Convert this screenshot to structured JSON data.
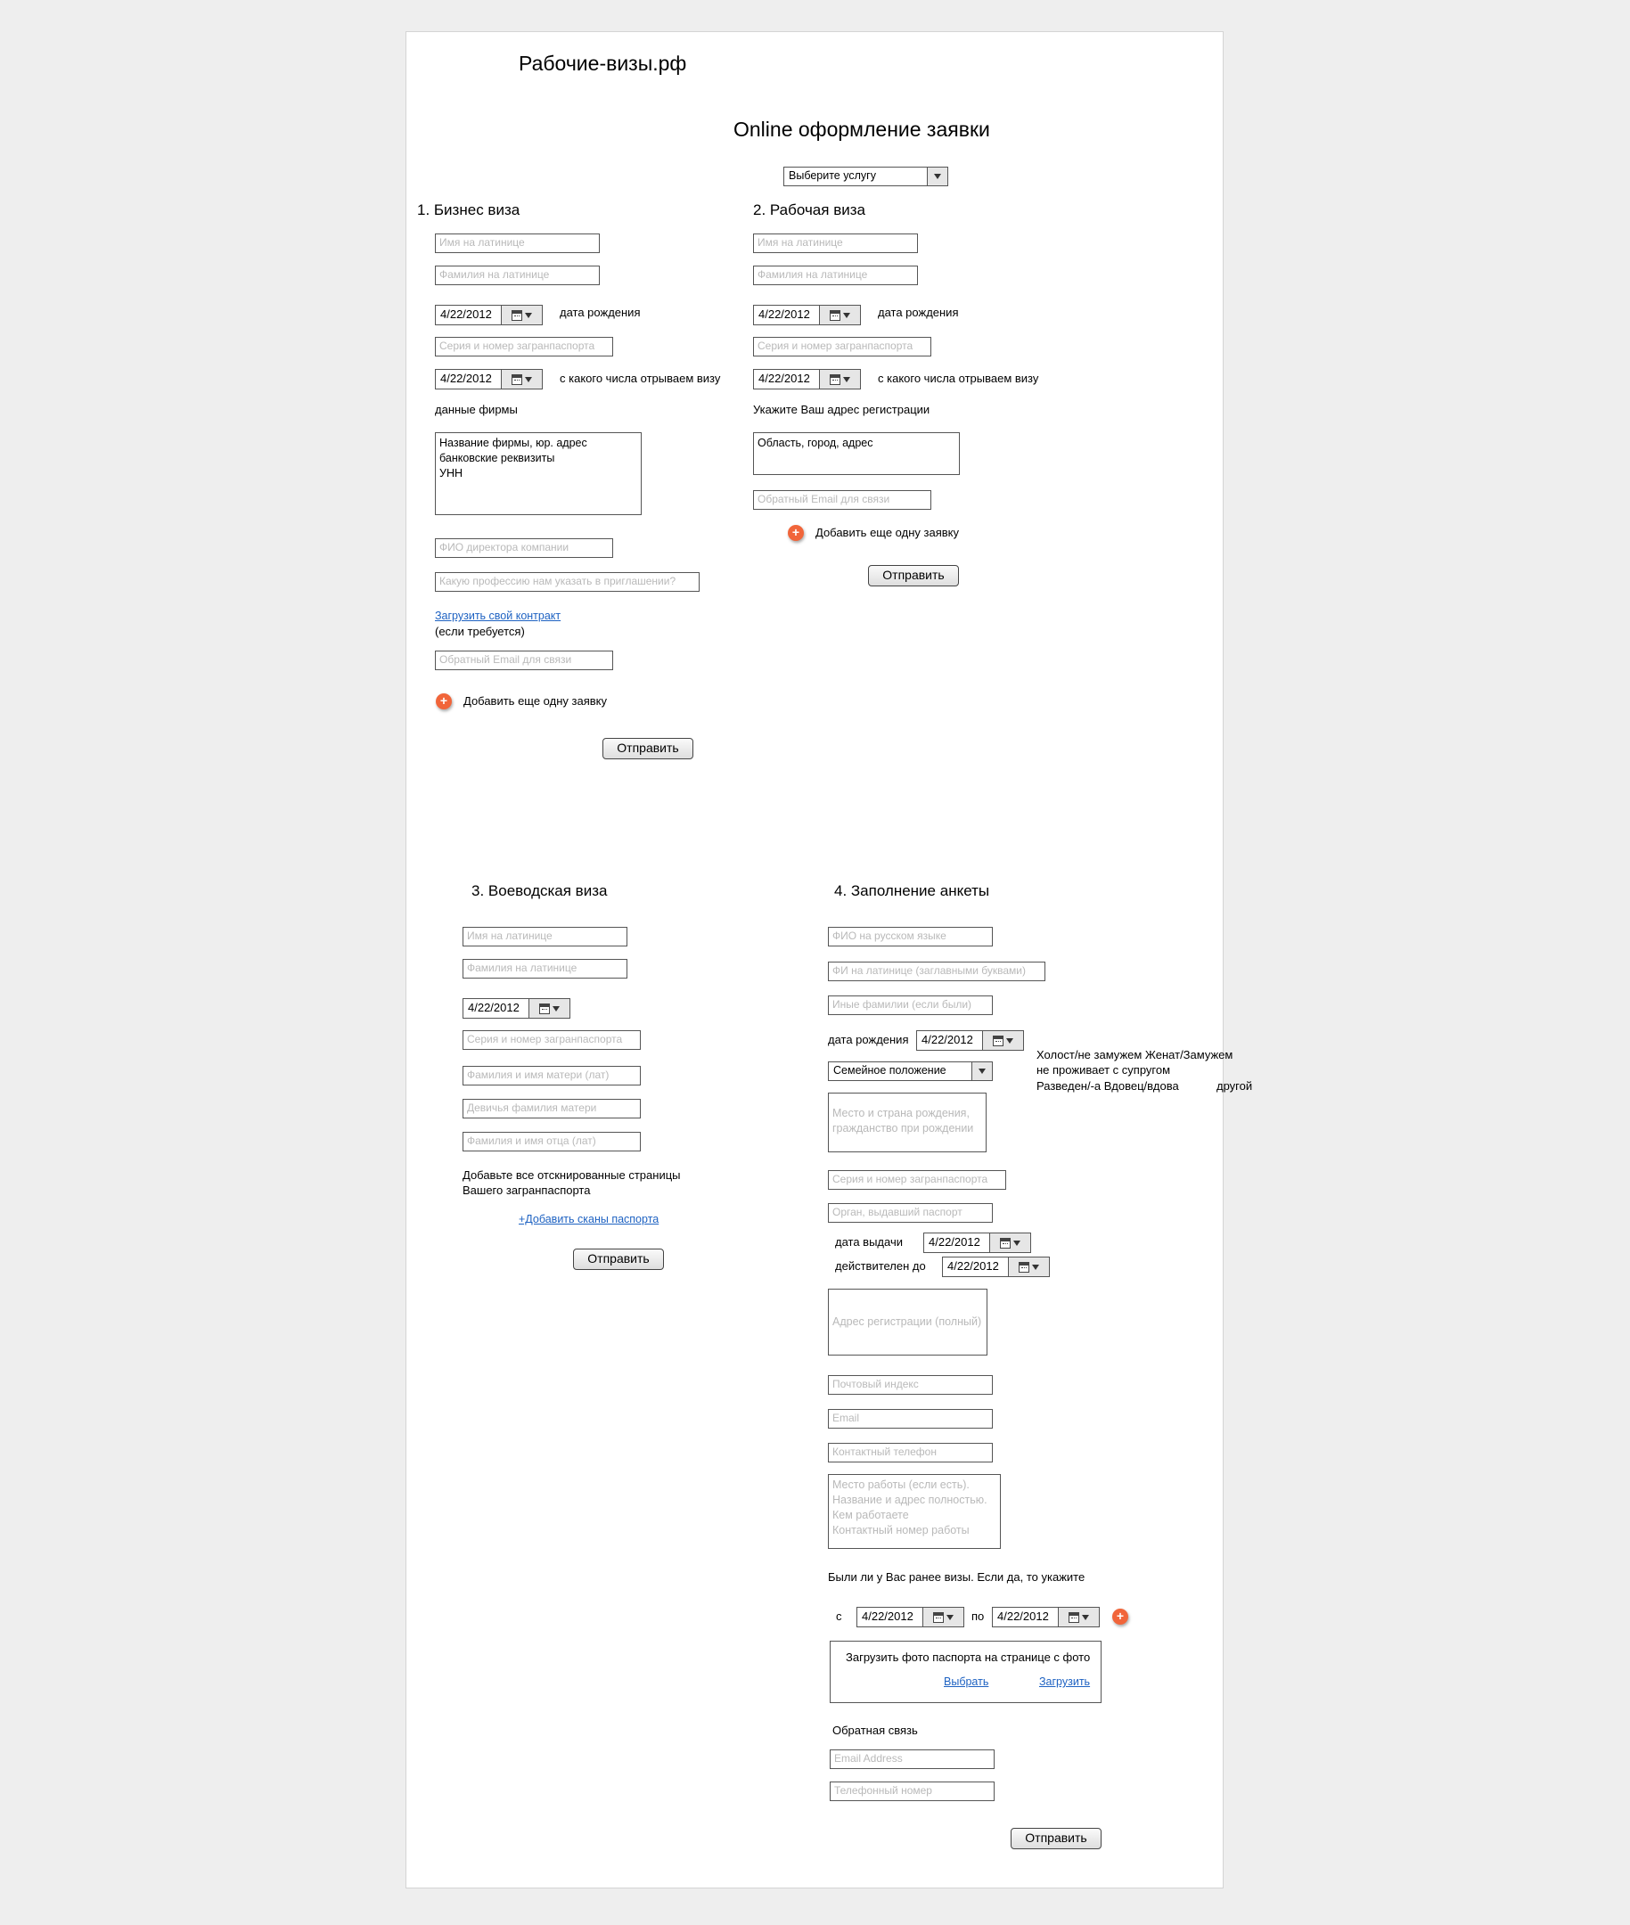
{
  "site": {
    "title": "Рабочие-визы.рф"
  },
  "header": {
    "title": "Online оформление заявки",
    "service_select": "Выберите услугу"
  },
  "s1": {
    "title": "1. Бизнес виза",
    "first_name_ph": "Имя на латинице",
    "last_name_ph": "Фамилия на латинице",
    "dob_value": "4/22/2012",
    "dob_label": "дата рождения",
    "passport_ph": "Серия и номер загранпаспорта",
    "visa_start_value": "4/22/2012",
    "visa_start_label": "с какого числа отрываем визу",
    "company_label": "данные фирмы",
    "company_text": "Название фирмы, юр. адрес\nбанковские реквизиты\nУНН",
    "director_ph": "ФИО директора компании",
    "profession_ph": "Какую профессию нам указать в приглашении?",
    "upload_link": "Загрузить свой контракт",
    "upload_note": "(если требуется)",
    "email_ph": "Обратный Email для связи",
    "add_more": "Добавить еще одну заявку",
    "submit": "Отправить"
  },
  "s2": {
    "title": "2. Рабочая виза",
    "first_name_ph": "Имя на латинице",
    "last_name_ph": "Фамилия на латинице",
    "dob_value": "4/22/2012",
    "dob_label": "дата рождения",
    "passport_ph": "Серия и номер загранпаспорта",
    "visa_start_value": "4/22/2012",
    "visa_start_label": "с какого числа отрываем визу",
    "address_label": "Укажите Ваш адрес регистрации",
    "address_text": "Область, город, адрес",
    "email_ph": "Обратный Email для связи",
    "add_more": "Добавить еще одну заявку",
    "submit": "Отправить"
  },
  "s3": {
    "title": "3. Воеводская виза",
    "first_name_ph": "Имя на латинице",
    "last_name_ph": "Фамилия на латинице",
    "dob_value": "4/22/2012",
    "passport_ph": "Серия и номер загранпаспорта",
    "mother_ph": "Фамилия и имя матери (лат)",
    "maiden_ph": "Девичья фамилия матери",
    "father_ph": "Фамилия и имя отца (лат)",
    "scans_text_1": "Добавьте все отскнированные страницы",
    "scans_text_2": "Вашего загранпаспорта",
    "scans_link": "+Добавить сканы паспорта",
    "submit": "Отправить"
  },
  "s4": {
    "title": "4. Заполнение анкеты",
    "fio_ru_ph": "ФИО на русском языке",
    "fi_lat_ph": "ФИ на латинице (заглавными буквами)",
    "other_names_ph": "Иные фамилии (если были)",
    "dob_label": "дата рождения",
    "dob_value": "4/22/2012",
    "marital_select": "Семейное положение",
    "marital_options": [
      "Холост/не замужем Женат/Замужем",
      "не проживает с супругом",
      "Разведен/-а Вдовец/вдова",
      "другой"
    ],
    "birthplace_text": "Место и страна рождения,\nгражданство при рождении",
    "passport_ph": "Серия и номер загранпаспорта",
    "issuer_ph": "Орган, выдавший паспорт",
    "issue_label": "дата выдачи",
    "issue_value": "4/22/2012",
    "valid_label": "действителен до",
    "valid_value": "4/22/2012",
    "reg_address_text": "Адрес регистрации (полный)",
    "postcode_ph": "Почтовый индекс",
    "email_ph": "Email",
    "phone_ph": "Контактный телефон",
    "work_text": "Место работы (если есть).\nНазвание и адрес полностью.\nКем работаете\nКонтактный номер работы",
    "prev_visas_label": "Были ли у Вас ранее визы. Если да, то укажите",
    "from_label": "с",
    "from_value": "4/22/2012",
    "to_label": "по",
    "to_value": "4/22/2012",
    "photo_title": "Загрузить фото паспорта на странице с фото",
    "photo_choose": "Выбрать",
    "photo_upload": "Загрузить",
    "feedback_label": "Обратная связь",
    "fb_email_ph": "Email Address",
    "fb_phone_ph": "Телефонный номер",
    "submit": "Отправить"
  },
  "icons": {
    "calendar": "calendar-icon",
    "dropdown": "chevron-down-icon",
    "add": "plus-icon"
  },
  "colors": {
    "accent": "#f1653a",
    "link": "#1e62c2",
    "background": "#eeeeee"
  }
}
